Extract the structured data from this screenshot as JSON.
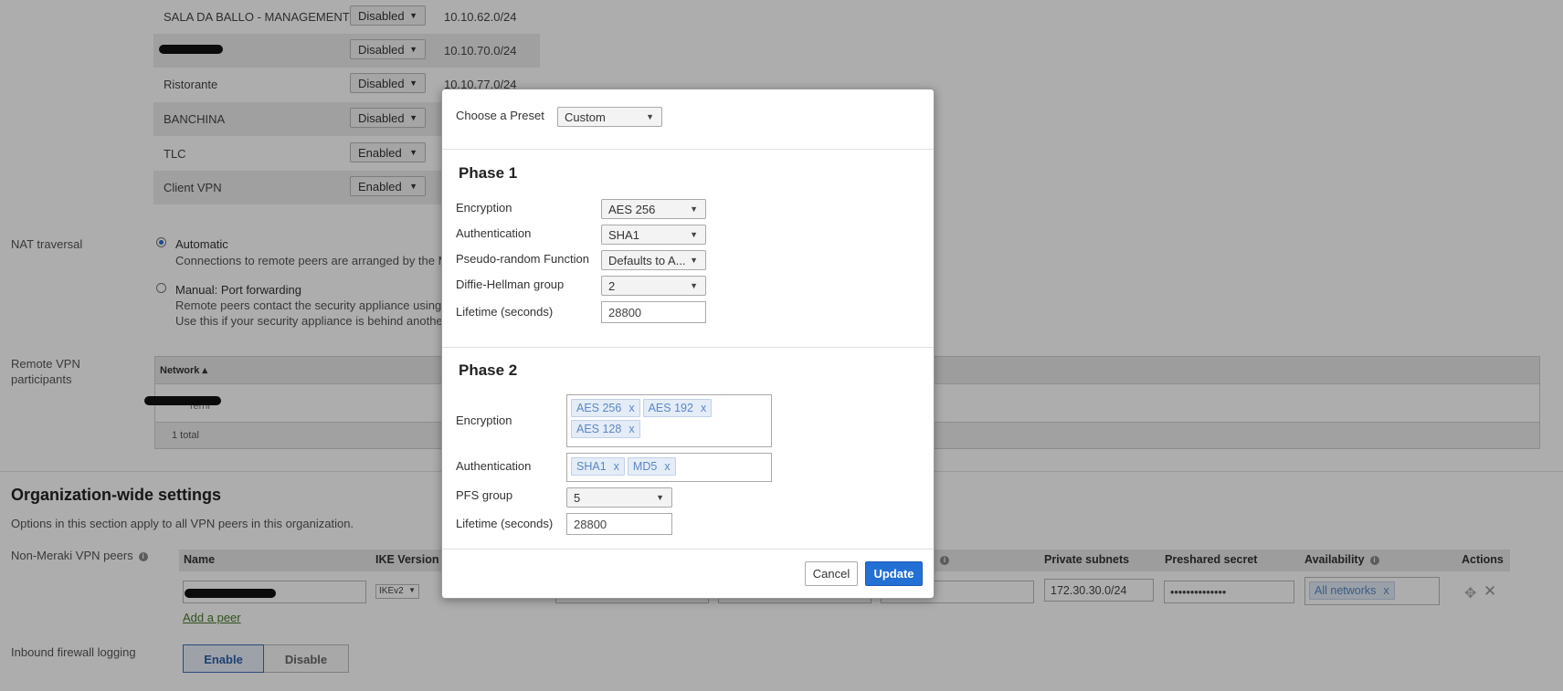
{
  "subnets": [
    {
      "name": "SALA DA BALLO - MANAGEMENT",
      "vpn": "Disabled",
      "subnet": "10.10.62.0/24"
    },
    {
      "name": "",
      "vpn": "Disabled",
      "subnet": "10.10.70.0/24"
    },
    {
      "name": "Ristorante",
      "vpn": "Disabled",
      "subnet": "10.10.77.0/24"
    },
    {
      "name": "BANCHINA",
      "vpn": "Disabled",
      "subnet": ""
    },
    {
      "name": "TLC",
      "vpn": "Enabled",
      "subnet": ""
    },
    {
      "name": "Client VPN",
      "vpn": "Enabled",
      "subnet": ""
    }
  ],
  "nat": {
    "label": "NAT traversal",
    "auto_label": "Automatic",
    "auto_desc": "Connections to remote peers are arranged by the Me",
    "manual_label": "Manual: Port forwarding",
    "manual_desc1": "Remote peers contact the security appliance using a",
    "manual_desc2": "Use this if your security appliance is behind another"
  },
  "remote_vpn": {
    "label": "Remote VPN participants",
    "col_network": "Network ▴",
    "row_tail": "Terni",
    "total": "1 total"
  },
  "org": {
    "title": "Organization-wide settings",
    "desc": "Options in this section apply to all VPN peers in this organization.",
    "peers_label": "Non-Meraki VPN peers",
    "cols": {
      "name": "Name",
      "ike": "IKE Version",
      "private_subnets": "Private subnets",
      "psk": "Preshared secret",
      "availability": "Availability",
      "actions": "Actions"
    },
    "peer": {
      "ike": "IKEv2",
      "private_subnets": "172.30.30.0/24",
      "psk": "••••••••••••••",
      "availability": "All networks"
    },
    "add_peer": "Add a peer",
    "firewall_label": "Inbound firewall logging",
    "enable": "Enable",
    "disable": "Disable"
  },
  "modal": {
    "preset_label": "Choose a Preset",
    "preset_value": "Custom",
    "phase1": {
      "title": "Phase 1",
      "encryption_label": "Encryption",
      "encryption_value": "AES 256",
      "auth_label": "Authentication",
      "auth_value": "SHA1",
      "prf_label": "Pseudo-random Function",
      "prf_value": "Defaults to A...",
      "dh_label": "Diffie-Hellman group",
      "dh_value": "2",
      "lifetime_label": "Lifetime (seconds)",
      "lifetime_value": "28800"
    },
    "phase2": {
      "title": "Phase 2",
      "encryption_label": "Encryption",
      "encryption_tags": [
        "AES 256",
        "AES 192",
        "AES 128"
      ],
      "auth_label": "Authentication",
      "auth_tags": [
        "SHA1",
        "MD5"
      ],
      "pfs_label": "PFS group",
      "pfs_value": "5",
      "lifetime_label": "Lifetime (seconds)",
      "lifetime_value": "28800"
    },
    "cancel": "Cancel",
    "update": "Update",
    "tag_remove": "x"
  },
  "colors": {
    "primary_button": "#2370d5",
    "tag_bg": "#e4ecf7",
    "tag_text": "#5b86c5"
  }
}
